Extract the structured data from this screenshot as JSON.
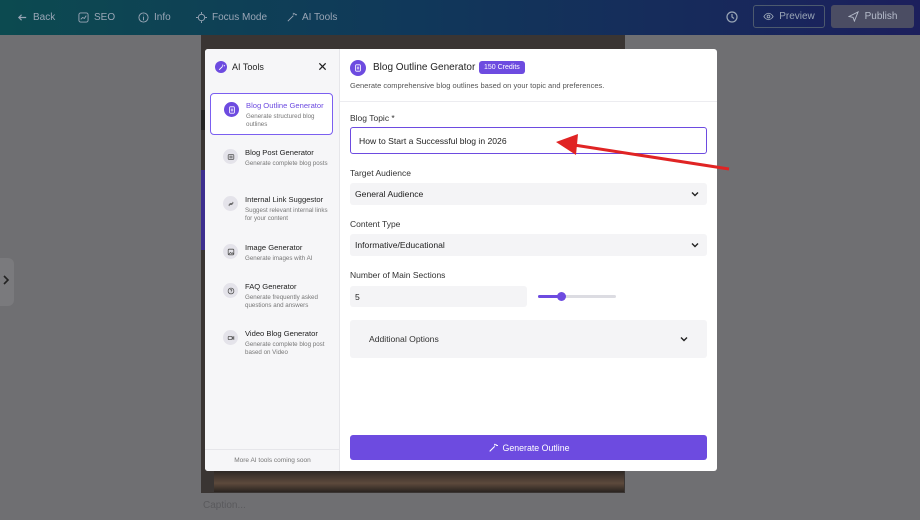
{
  "topbar": {
    "back": "Back",
    "seo": "SEO",
    "info": "Info",
    "focus": "Focus Mode",
    "ai_tools": "AI Tools",
    "preview": "Preview",
    "publish": "Publish"
  },
  "background": {
    "caption_placeholder": "Caption..."
  },
  "sidebar": {
    "title": "AI Tools",
    "footer": "More AI tools coming soon",
    "items": [
      {
        "label": "Blog Outline Generator",
        "desc": "Generate structured blog outlines",
        "icon": "document-icon"
      },
      {
        "label": "Blog Post Generator",
        "desc": "Generate complete blog posts",
        "icon": "article-icon"
      },
      {
        "label": "Internal Link Suggestor",
        "desc": "Suggest relevant internal links for your content",
        "icon": "link-icon"
      },
      {
        "label": "Image Generator",
        "desc": "Generate images with AI",
        "icon": "image-icon"
      },
      {
        "label": "FAQ Generator",
        "desc": "Generate frequently asked questions and answers",
        "icon": "help-icon"
      },
      {
        "label": "Video Blog Generator",
        "desc": "Generate complete blog post based on Video",
        "icon": "video-icon"
      }
    ]
  },
  "main": {
    "title": "Blog Outline Generator",
    "credits_badge": "150 Credits",
    "subtitle": "Generate comprehensive blog outlines based on your topic and preferences.",
    "topic_label": "Blog Topic *",
    "topic_value": "How to Start a Successful blog in 2026",
    "audience_label": "Target Audience",
    "audience_value": "General Audience",
    "content_type_label": "Content Type",
    "content_type_value": "Informative/Educational",
    "sections_label": "Number of Main Sections",
    "sections_value": "5",
    "sections_slider_fraction": 0.3,
    "additional_options": "Additional Options",
    "generate_button": "Generate Outline"
  },
  "colors": {
    "accent": "#6d4be0",
    "annotation_arrow": "#e02424"
  }
}
